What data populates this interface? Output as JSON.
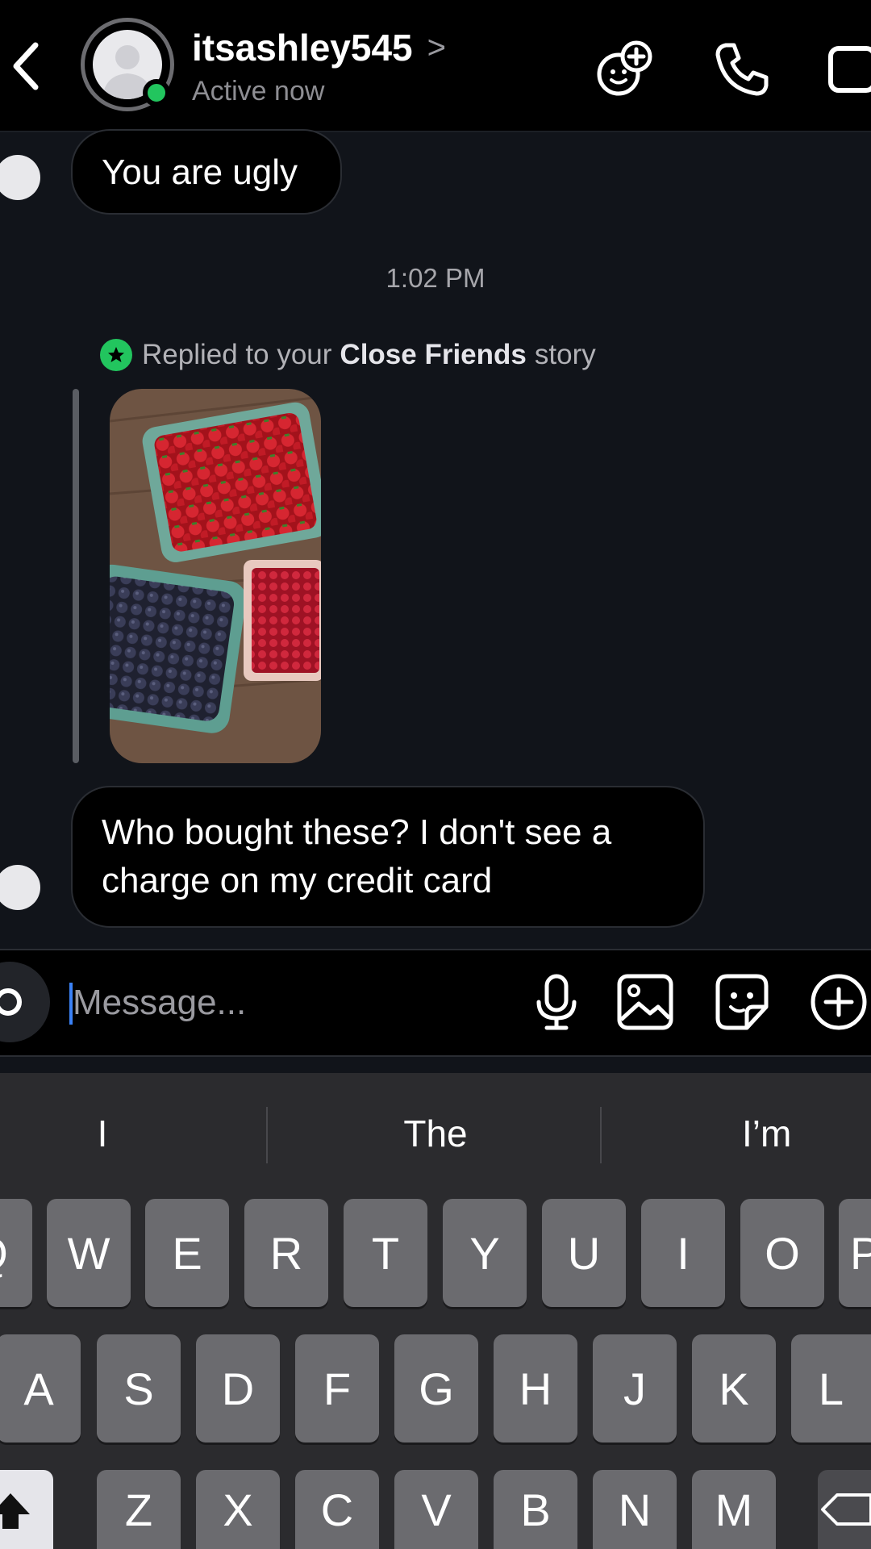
{
  "header": {
    "username": "itsashley545",
    "username_chevron": ">",
    "status": "Active now",
    "icons": [
      "back-icon",
      "video-effects-icon",
      "phone-icon",
      "video-icon"
    ]
  },
  "messages": [
    {
      "text": "You are ugly"
    }
  ],
  "timestamp": "1:02 PM",
  "story_reply": {
    "prefix": "Replied to your",
    "highlight": "Close Friends",
    "suffix": "story"
  },
  "message2": {
    "line1": "Who bought these? I don't see a",
    "line2": "charge on my credit card"
  },
  "composer": {
    "placeholder": "Message...",
    "icons": [
      "camera-icon",
      "microphone-icon",
      "image-icon",
      "sticker-icon",
      "add-icon"
    ]
  },
  "keyboard": {
    "suggestions": [
      "I",
      "The",
      "I’m"
    ],
    "row1": [
      "Q",
      "W",
      "E",
      "R",
      "T",
      "Y",
      "U",
      "I",
      "O",
      "P"
    ],
    "row2": [
      "A",
      "S",
      "D",
      "F",
      "G",
      "H",
      "J",
      "K",
      "L"
    ],
    "row3": [
      "Z",
      "X",
      "C",
      "V",
      "B",
      "N",
      "M"
    ]
  },
  "colors": {
    "online": "#22c55e",
    "caret": "#3b82f6",
    "bubble": "#000000",
    "background": "#11141a"
  }
}
